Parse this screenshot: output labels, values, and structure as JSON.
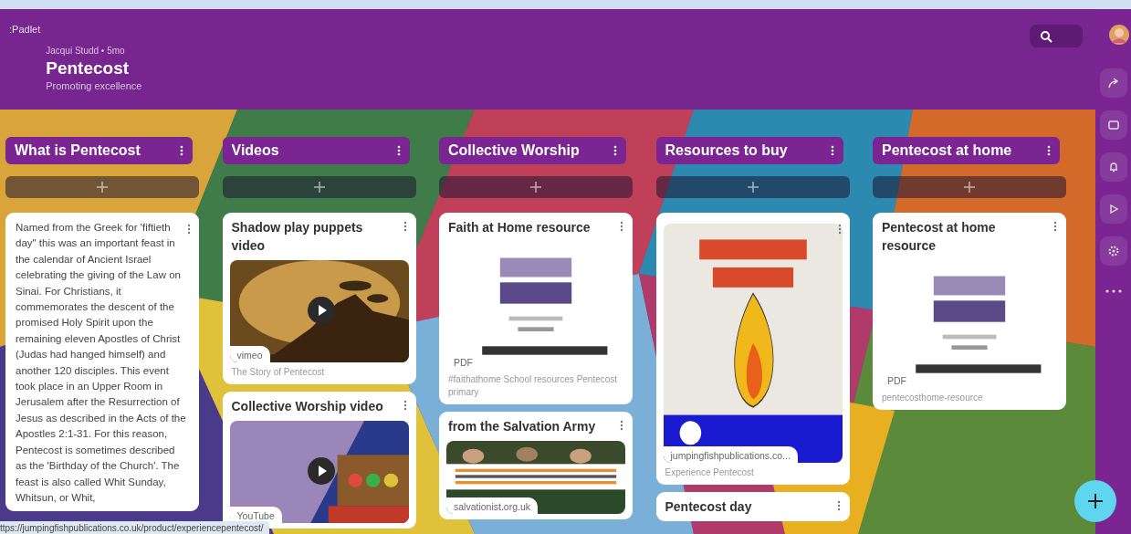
{
  "header": {
    "logo": ":Padlet",
    "byline": "Jacqui Studd • 5mo",
    "title": "Pentecost",
    "subtitle": "Promoting excellence"
  },
  "columns": [
    {
      "title": "What is Pentecost",
      "cards": [
        {
          "text": "Named from the Greek for 'fiftieth day\" this was an important feast in the calendar of Ancient Israel celebrating the giving of the Law on Sinai. For Christians, it commemorates the descent of the promised Holy Spirit upon the remaining eleven Apostles of Christ (Judas had hanged himself) and another 120 disciples. This event took place in an Upper Room in Jerusalem after the Resurrection of Jesus as described in the Acts of the Apostles 2:1-31. For this reason, Pentecost is sometimes described as the 'Birthday of the Church'. The feast is also called Whit Sunday, Whitsun, or Whit,"
        }
      ]
    },
    {
      "title": "Videos",
      "cards": [
        {
          "title": "Shadow play puppets video",
          "media": {
            "kind": "video",
            "badge": "vimeo"
          },
          "caption": "The Story of Pentecost"
        },
        {
          "title": "Collective Worship video",
          "media": {
            "kind": "video",
            "badge": "YouTube"
          }
        }
      ]
    },
    {
      "title": "Collective Worship",
      "cards": [
        {
          "title": "Faith at Home resource",
          "media": {
            "kind": "pdf",
            "badge": "PDF"
          },
          "caption": "#faithathome School resources Pentecost primary"
        },
        {
          "title": "from the Salvation Army",
          "media": {
            "badge": "salvationist.org.uk"
          }
        }
      ]
    },
    {
      "title": "Resources to buy",
      "cards": [
        {
          "media": {
            "kind": "poster",
            "badge": "jumpingfishpublications.co..."
          },
          "caption": "Experience Pentecost"
        },
        {
          "title": "Pentecost day"
        }
      ]
    },
    {
      "title": "Pentecost at home",
      "cards": [
        {
          "title": "Pentecost at home resource",
          "media": {
            "kind": "pdf",
            "badge": "PDF"
          },
          "caption": "pentecosthome-resource"
        }
      ]
    }
  ],
  "status_bar": {
    "url": "ttps://jumpingfishpublications.co.uk/product/experiencepentecost/"
  }
}
